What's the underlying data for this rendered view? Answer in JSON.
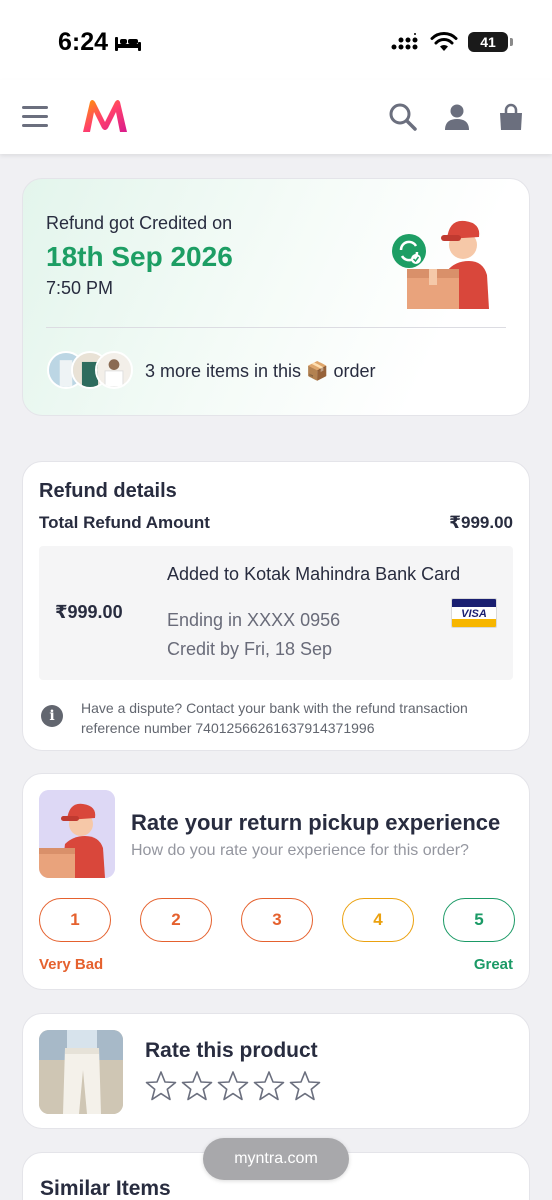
{
  "status_bar": {
    "time": "6:24",
    "battery": "41"
  },
  "header": {
    "logo_alt": "Myntra"
  },
  "refund_status": {
    "label": "Refund got Credited on",
    "date": "18th Sep 2026",
    "time": "7:50 PM",
    "more_items_text": "3 more items in this 📦 order"
  },
  "refund_details": {
    "title": "Refund details",
    "total_label": "Total Refund Amount",
    "total_amount": "₹999.00",
    "inner_amount": "₹999.00",
    "added_to": "Added to Kotak Mahindra Bank Card",
    "ending": "Ending in XXXX 0956",
    "credit_by": "Credit by Fri, 18 Sep",
    "card_brand": "VISA",
    "dispute_text": "Have a dispute? Contact your bank with the refund transaction reference number 74012566261637914371996"
  },
  "rate_pickup": {
    "title": "Rate your return pickup experience",
    "subtitle": "How do you rate your experience for this order?",
    "ratings": [
      {
        "label": "1",
        "color": "#e5612e"
      },
      {
        "label": "2",
        "color": "#e5612e"
      },
      {
        "label": "3",
        "color": "#e5612e"
      },
      {
        "label": "4",
        "color": "#eba10f"
      },
      {
        "label": "5",
        "color": "#1b9a66"
      }
    ],
    "low_label": "Very Bad",
    "high_label": "Great"
  },
  "rate_product": {
    "title": "Rate this product",
    "stars": 5
  },
  "similar": {
    "title": "Similar Items"
  },
  "browser": {
    "url": "myntra.com"
  },
  "colors": {
    "green": "#1d9e64",
    "orange": "#e5612e",
    "yellow": "#eba10f",
    "brand_pink": "#ff3f6c"
  }
}
